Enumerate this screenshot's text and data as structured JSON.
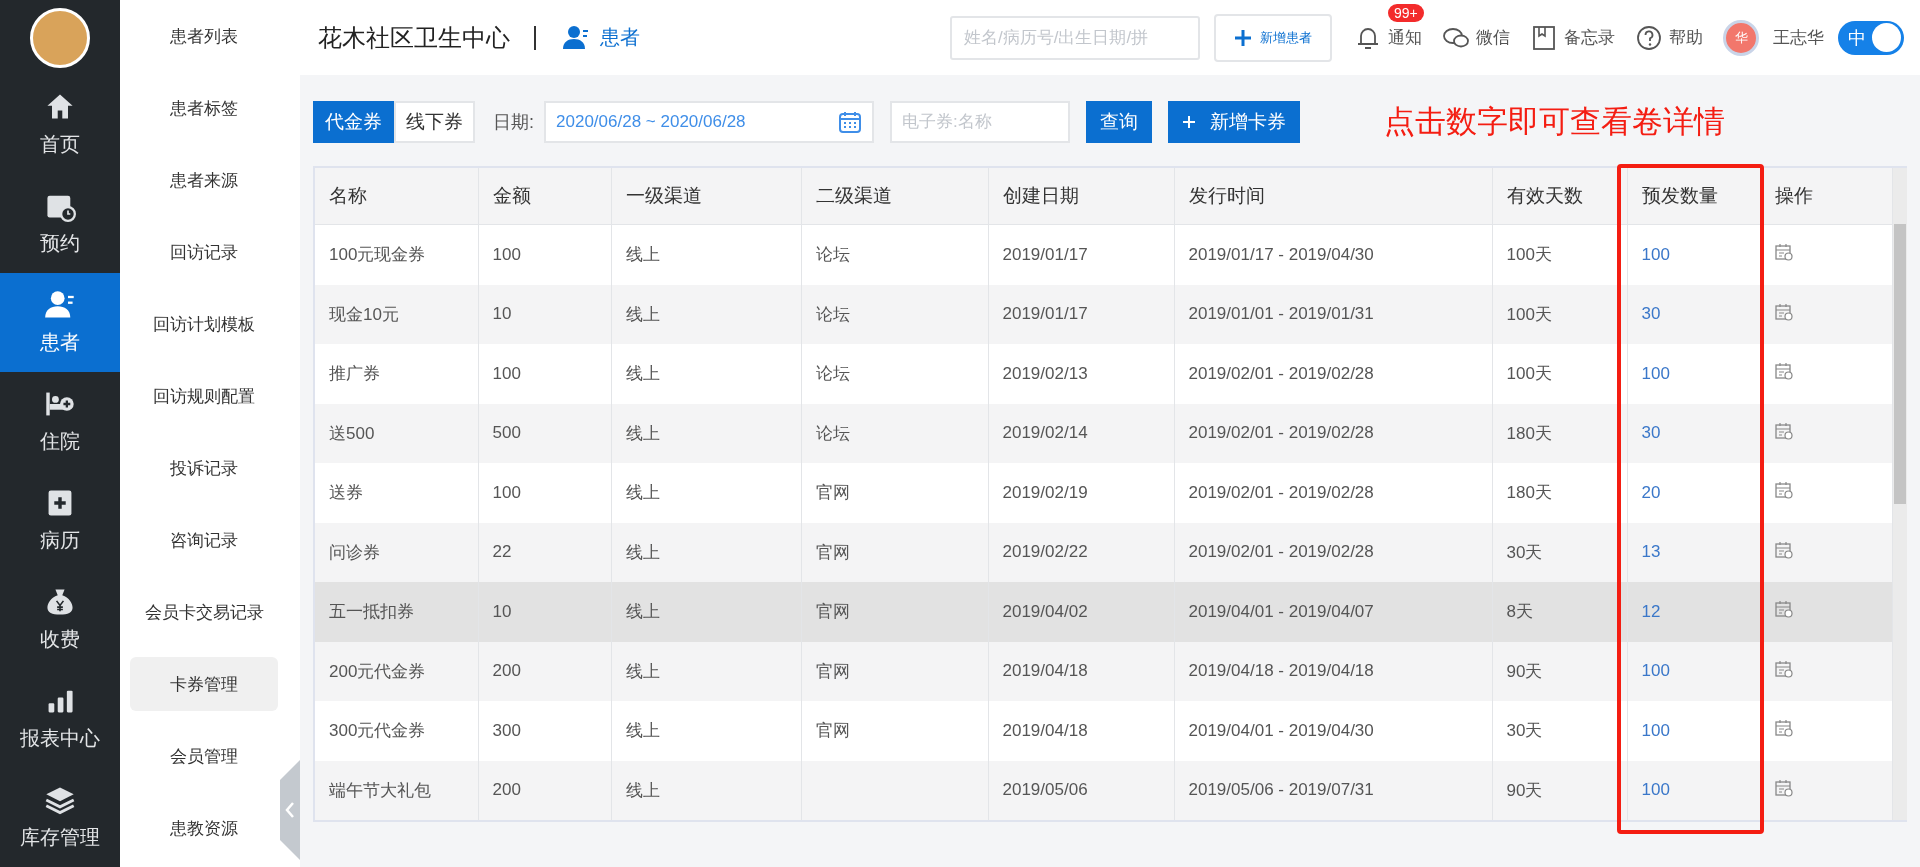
{
  "nav": {
    "items": [
      {
        "label": "首页",
        "selected": false
      },
      {
        "label": "预约",
        "selected": false
      },
      {
        "label": "患者",
        "selected": true
      },
      {
        "label": "住院",
        "selected": false
      },
      {
        "label": "病历",
        "selected": false
      },
      {
        "label": "收费",
        "selected": false
      },
      {
        "label": "报表中心",
        "selected": false
      },
      {
        "label": "库存管理",
        "selected": false
      }
    ]
  },
  "sub_nav": {
    "items": [
      {
        "label": "患者列表",
        "selected": false
      },
      {
        "label": "患者标签",
        "selected": false
      },
      {
        "label": "患者来源",
        "selected": false
      },
      {
        "label": "回访记录",
        "selected": false
      },
      {
        "label": "回访计划模板",
        "selected": false
      },
      {
        "label": "回访规则配置",
        "selected": false
      },
      {
        "label": "投诉记录",
        "selected": false
      },
      {
        "label": "咨询记录",
        "selected": false
      },
      {
        "label": "会员卡交易记录",
        "selected": false
      },
      {
        "label": "卡券管理",
        "selected": true
      },
      {
        "label": "会员管理",
        "selected": false
      },
      {
        "label": "患教资源",
        "selected": false
      }
    ]
  },
  "header": {
    "title": "花木社区卫生中心",
    "module": "患者",
    "search": {
      "placeholder": "姓名/病历号/出生日期/拼"
    },
    "add_button": "新增患者",
    "links": [
      {
        "label": "通知",
        "badge": "99+"
      },
      {
        "label": "微信"
      },
      {
        "label": "备忘录"
      },
      {
        "label": "帮助"
      }
    ],
    "user": {
      "avatar": "华",
      "name": "王志华"
    },
    "toggle": {
      "label": "中",
      "on": true
    }
  },
  "toolbar": {
    "tabs": [
      {
        "label": "代金券",
        "selected": true
      },
      {
        "label": "线下券",
        "selected": false
      }
    ],
    "date_label": "日期:",
    "date_range": "2020/06/28 ~ 2020/06/28",
    "search": {
      "placeholder": "电子券:名称"
    },
    "query_button": "查询",
    "add_button": "新增卡券",
    "annotation": "点击数字即可查看卷详情"
  },
  "table": {
    "columns": [
      "名称",
      "金额",
      "一级渠道",
      "二级渠道",
      "创建日期",
      "发行时间",
      "有效天数",
      "预发数量",
      "操作"
    ],
    "rows": [
      {
        "highlighted": false,
        "cells": [
          "100元现金券",
          "100",
          "线上",
          "论坛",
          "2019/01/17",
          "2019/01/17 - 2019/04/30",
          "100天",
          "100"
        ]
      },
      {
        "highlighted": false,
        "cells": [
          "现金10元",
          "10",
          "线上",
          "论坛",
          "2019/01/17",
          "2019/01/01 - 2019/01/31",
          "100天",
          "30"
        ]
      },
      {
        "highlighted": false,
        "cells": [
          "推广券",
          "100",
          "线上",
          "论坛",
          "2019/02/13",
          "2019/02/01 - 2019/02/28",
          "100天",
          "100"
        ]
      },
      {
        "highlighted": false,
        "cells": [
          "送500",
          "500",
          "线上",
          "论坛",
          "2019/02/14",
          "2019/02/01 - 2019/02/28",
          "180天",
          "30"
        ]
      },
      {
        "highlighted": false,
        "cells": [
          "送券",
          "100",
          "线上",
          "官网",
          "2019/02/19",
          "2019/02/01 - 2019/02/28",
          "180天",
          "20"
        ]
      },
      {
        "highlighted": false,
        "cells": [
          "问诊券",
          "22",
          "线上",
          "官网",
          "2019/02/22",
          "2019/02/01 - 2019/02/28",
          "30天",
          "13"
        ]
      },
      {
        "highlighted": true,
        "cells": [
          "五一抵扣券",
          "10",
          "线上",
          "官网",
          "2019/04/02",
          "2019/04/01 - 2019/04/07",
          "8天",
          "12"
        ]
      },
      {
        "highlighted": false,
        "cells": [
          "200元代金券",
          "200",
          "线上",
          "官网",
          "2019/04/18",
          "2019/04/18 - 2019/04/18",
          "90天",
          "100"
        ]
      },
      {
        "highlighted": false,
        "cells": [
          "300元代金券",
          "300",
          "线上",
          "官网",
          "2019/04/18",
          "2019/04/01 - 2019/04/30",
          "30天",
          "100"
        ]
      },
      {
        "highlighted": false,
        "cells": [
          "端午节大礼包",
          "200",
          "线上",
          null,
          "2019/05/06",
          "2019/05/06 - 2019/07/31",
          "90天",
          "100"
        ]
      }
    ]
  }
}
